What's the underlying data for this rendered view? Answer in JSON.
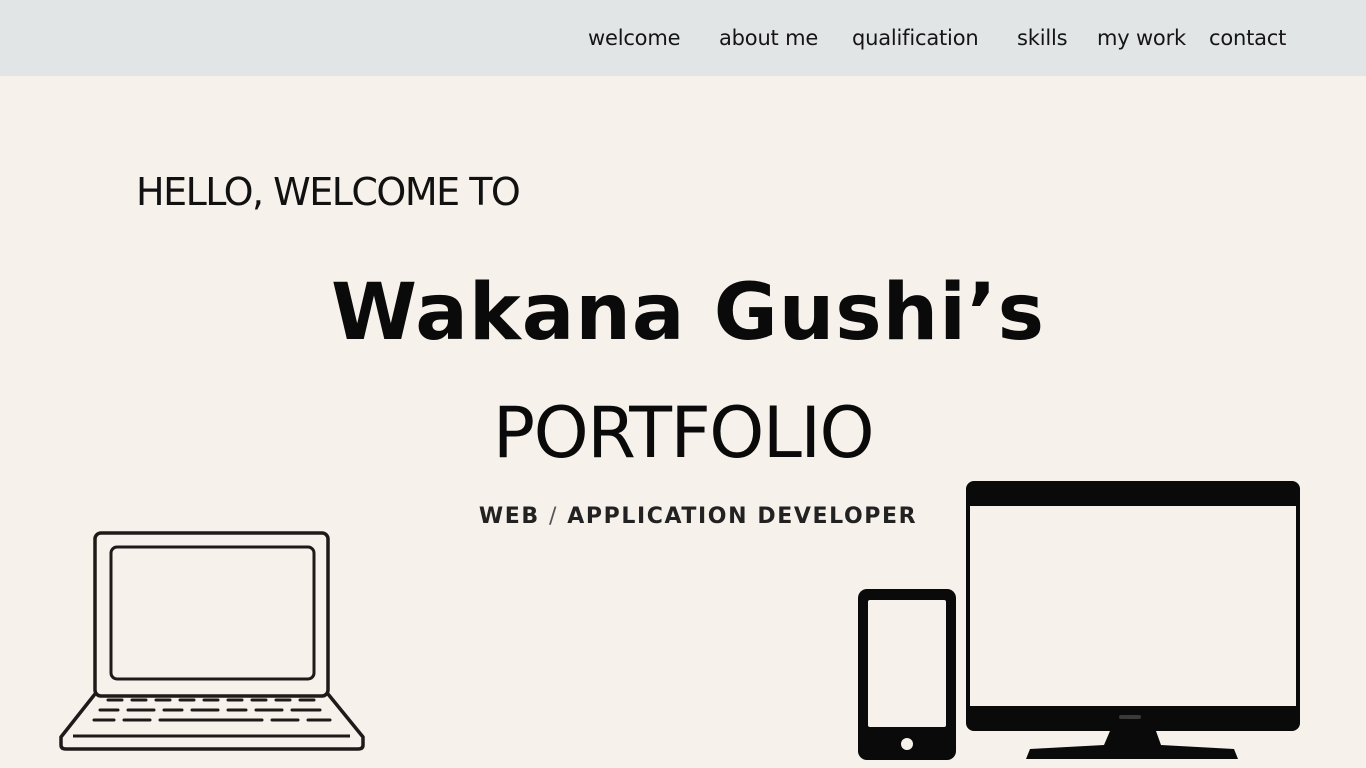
{
  "nav": {
    "items": [
      {
        "label": "welcome"
      },
      {
        "label": "about me"
      },
      {
        "label": "qualification"
      },
      {
        "label": "skills"
      },
      {
        "label": "my work"
      },
      {
        "label": "contact"
      }
    ]
  },
  "hero": {
    "greeting": "HELLO, WELCOME TO",
    "name": "Wakana Gushi’s",
    "title": "PORTFOLIO",
    "role_part1": "WEB",
    "role_separator": "/",
    "role_part2": "APPLICATION DEVELOPER"
  },
  "illustrations": {
    "left": "laptop-icon",
    "right_phone": "smartphone-icon",
    "right_monitor": "monitor-icon"
  },
  "colors": {
    "background": "#f6f1eb",
    "navbar": "#e2e5e6",
    "text": "#111111"
  }
}
